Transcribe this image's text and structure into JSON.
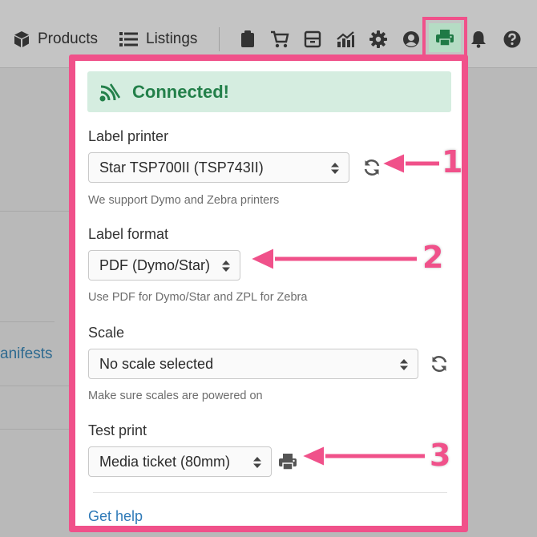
{
  "nav": {
    "products_label": "Products",
    "listings_label": "Listings",
    "icons": [
      "clipboard-icon",
      "cart-icon",
      "archive-icon",
      "chart-icon",
      "gear-icon",
      "user-circle-icon",
      "printer-icon",
      "bell-icon",
      "help-icon"
    ]
  },
  "background": {
    "manifests_label": "anifests"
  },
  "popover": {
    "status": "Connected!",
    "label_printer": {
      "label": "Label printer",
      "value": "Star TSP700II (TSP743II)",
      "help": "We support Dymo and Zebra printers"
    },
    "label_format": {
      "label": "Label format",
      "value": "PDF (Dymo/Star)",
      "help": "Use PDF for Dymo/Star and ZPL for Zebra"
    },
    "scale": {
      "label": "Scale",
      "value": "No scale selected",
      "help": "Make sure scales are powered on"
    },
    "test_print": {
      "label": "Test print",
      "value": "Media ticket (80mm)"
    },
    "get_help": "Get help"
  },
  "annotations": {
    "one": "1",
    "two": "2",
    "three": "3"
  },
  "colors": {
    "highlight": "#f0518a",
    "success_bg": "#d5ede0",
    "success_text": "#23804a",
    "link": "#2f7ab8"
  }
}
